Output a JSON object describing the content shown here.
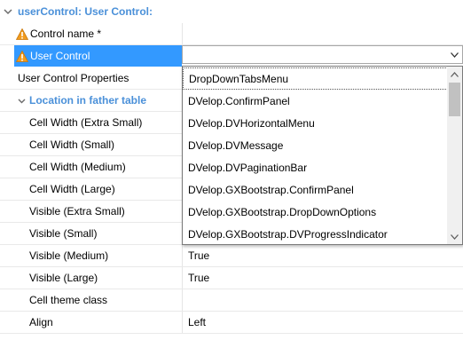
{
  "header": {
    "title": "userControl: User Control:"
  },
  "rows": {
    "control_name": {
      "label": "Control name *",
      "value": ""
    },
    "user_control": {
      "label": "User Control",
      "value": ""
    },
    "user_control_properties": {
      "label": "User Control Properties",
      "value": ""
    },
    "location_group": {
      "label": "Location in father table"
    },
    "cell_width_xs": {
      "label": "Cell Width (Extra Small)",
      "value": ""
    },
    "cell_width_s": {
      "label": "Cell Width (Small)",
      "value": ""
    },
    "cell_width_m": {
      "label": "Cell Width (Medium)",
      "value": ""
    },
    "cell_width_l": {
      "label": "Cell Width (Large)",
      "value": ""
    },
    "visible_xs": {
      "label": "Visible (Extra Small)",
      "value": ""
    },
    "visible_s": {
      "label": "Visible (Small)",
      "value": ""
    },
    "visible_m": {
      "label": "Visible (Medium)",
      "value": "True"
    },
    "visible_l": {
      "label": "Visible (Large)",
      "value": "True"
    },
    "cell_theme_class": {
      "label": "Cell theme class",
      "value": ""
    },
    "align": {
      "label": "Align",
      "value": "Left"
    }
  },
  "dropdown": {
    "options": [
      "DropDownTabsMenu",
      "DVelop.ConfirmPanel",
      "DVelop.DVHorizontalMenu",
      "DVelop.DVMessage",
      "DVelop.DVPaginationBar",
      "DVelop.GXBootstrap.ConfirmPanel",
      "DVelop.GXBootstrap.DropDownOptions",
      "DVelop.GXBootstrap.DVProgressIndicator"
    ]
  },
  "colors": {
    "accent": "#4a90d9",
    "selection": "#3399ff",
    "warning": "#f29b1d"
  },
  "icons": {
    "header_toggle": "chevron-down-icon",
    "group_toggle": "chevron-down-icon",
    "warning": "warning-icon",
    "combo_arrow": "chevron-down-icon",
    "scroll_up": "chevron-up-icon",
    "scroll_down": "chevron-down-icon"
  }
}
